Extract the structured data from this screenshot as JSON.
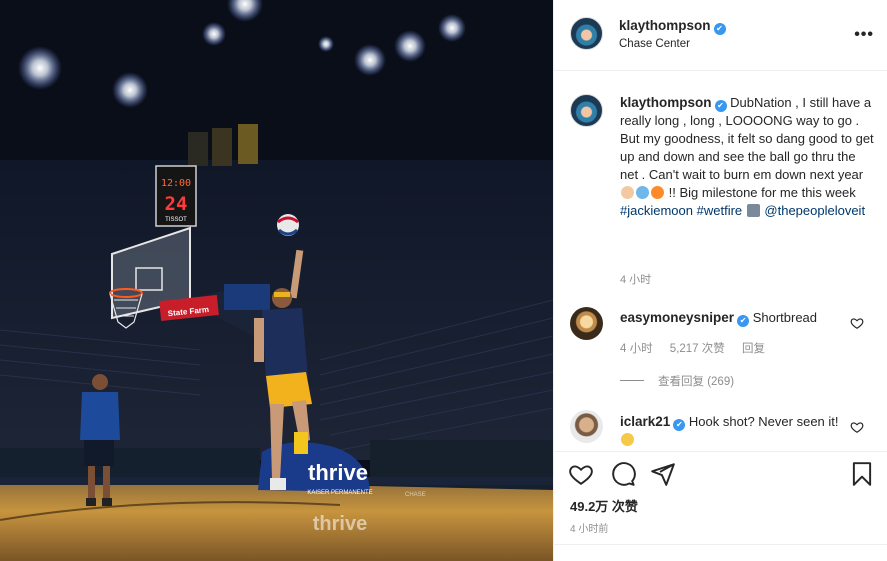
{
  "post": {
    "username": "klaythompson",
    "location": "Chase Center",
    "verified_mark": "✔",
    "more_label": "•••"
  },
  "photo": {
    "shot_clock_time": "12:00",
    "shot_clock_seconds": "24",
    "shot_clock_brand": "TISSOT",
    "backboard_sponsor": "State Farm",
    "banner_text": "thrive",
    "banner_subtext": "KAISER PERMANENTE",
    "court_logo_text": "thrive",
    "floor_ad": "CHASE"
  },
  "caption": {
    "username": "klaythompson",
    "text_1": "DubNation , I still have a really long , long , LOOOONG way to go . But my goodness, it felt so dang good to get up and down and see the ball go thru the net . Can't wait to burn em down next year",
    "text_2": "!!",
    "text_3": "Big milestone for me this week",
    "hashtag_1": "#jackiemoon",
    "hashtag_2": "#wetfire",
    "mention": "@thepeopleloveit",
    "time": "4 小时"
  },
  "comments": [
    {
      "username": "easymoneysniper",
      "text": "Shortbread",
      "time": "4 小时",
      "likes": "5,217 次赞",
      "reply_label": "回复",
      "view_replies": "查看回复 (269)"
    },
    {
      "username": "iclark21",
      "text": "Hook shot? Never seen it!"
    }
  ],
  "icons": {
    "like": "heart-icon",
    "comment": "comment-icon",
    "share": "paper-plane-icon",
    "save": "bookmark-icon",
    "more": "more-horizontal-icon"
  },
  "stats": {
    "likes": "49.2万 次赞",
    "posted": "4 小时前"
  },
  "colors": {
    "link": "#00376b",
    "verified": "#3897f0",
    "secondary_text": "#8e8e8e"
  }
}
